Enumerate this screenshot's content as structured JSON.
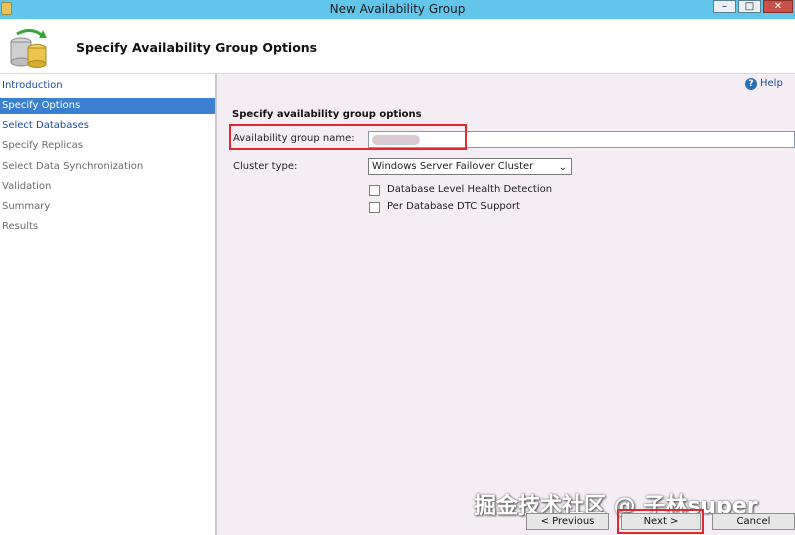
{
  "window": {
    "title": "New Availability Group",
    "minimize": "–",
    "maximize": "□",
    "close": "✕",
    "icon": "database-icon"
  },
  "header": {
    "title": "Specify Availability Group Options",
    "icon": "availability-group-database-icon"
  },
  "sidebar": {
    "items": [
      {
        "label": "Introduction",
        "state": "link"
      },
      {
        "label": "Specify Options",
        "state": "active"
      },
      {
        "label": "Select Databases",
        "state": "link"
      },
      {
        "label": "Specify Replicas",
        "state": "dim"
      },
      {
        "label": "Select Data Synchronization",
        "state": "dim"
      },
      {
        "label": "Validation",
        "state": "dim"
      },
      {
        "label": "Summary",
        "state": "dim"
      },
      {
        "label": "Results",
        "state": "dim"
      }
    ]
  },
  "help": {
    "label": "Help",
    "icon": "help-icon"
  },
  "form": {
    "section_title": "Specify availability group options",
    "ag_name_label": "Availability group name:",
    "ag_name_value": "",
    "cluster_type_label": "Cluster type:",
    "cluster_type_value": "Windows Server Failover Cluster",
    "checkboxes": [
      {
        "label": "Database Level Health Detection",
        "checked": false
      },
      {
        "label": "Per Database DTC Support",
        "checked": false
      }
    ]
  },
  "watermark": "掘金技术社区 @ 子林super",
  "buttons": {
    "previous": "< Previous",
    "next": "Next >",
    "cancel": "Cancel"
  },
  "colors": {
    "titlebar": "#62c6ea",
    "active_nav": "#3a7fd1",
    "link": "#1a4da1",
    "highlight": "#e0282e"
  }
}
